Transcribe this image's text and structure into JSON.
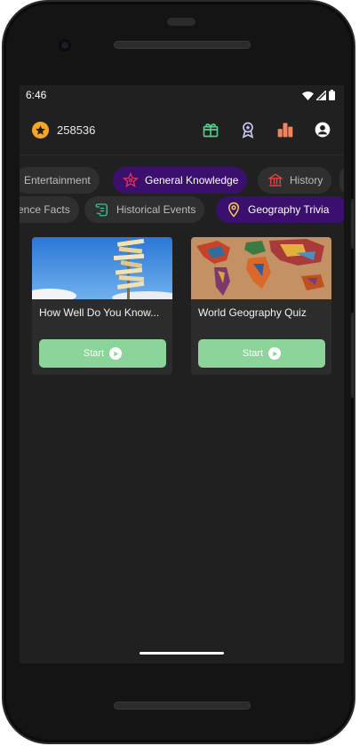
{
  "status_bar": {
    "time": "6:46",
    "icons": [
      "wifi-icon",
      "signal-icon",
      "battery-icon"
    ]
  },
  "header": {
    "coin_icon": "star-coin-icon",
    "coin_count": "258536",
    "actions": [
      "gift-icon",
      "badge-icon",
      "leaderboard-icon",
      "profile-icon"
    ]
  },
  "category_rows": {
    "row1": [
      {
        "label": "Entertainment",
        "icon": "none",
        "active": false
      },
      {
        "label": "General Knowledge",
        "icon": "brain-star-icon",
        "active": true
      },
      {
        "label": "History",
        "icon": "temple-icon",
        "active": false
      }
    ],
    "row2": [
      {
        "label": "ence Facts",
        "icon": "none",
        "active": false
      },
      {
        "label": "Historical Events",
        "icon": "scroll-icon",
        "active": false
      },
      {
        "label": "Geography Trivia",
        "icon": "map-pin-icon",
        "active": true
      }
    ]
  },
  "quizzes": [
    {
      "title": "How Well Do You Know...",
      "image": "signpost-image",
      "button": "Start"
    },
    {
      "title": "World Geography Quiz",
      "image": "world-map-image",
      "button": "Start"
    }
  ],
  "colors": {
    "accent_active": "#3a0f6e",
    "start_button": "#8bd49a",
    "coin": "#f5a623"
  }
}
